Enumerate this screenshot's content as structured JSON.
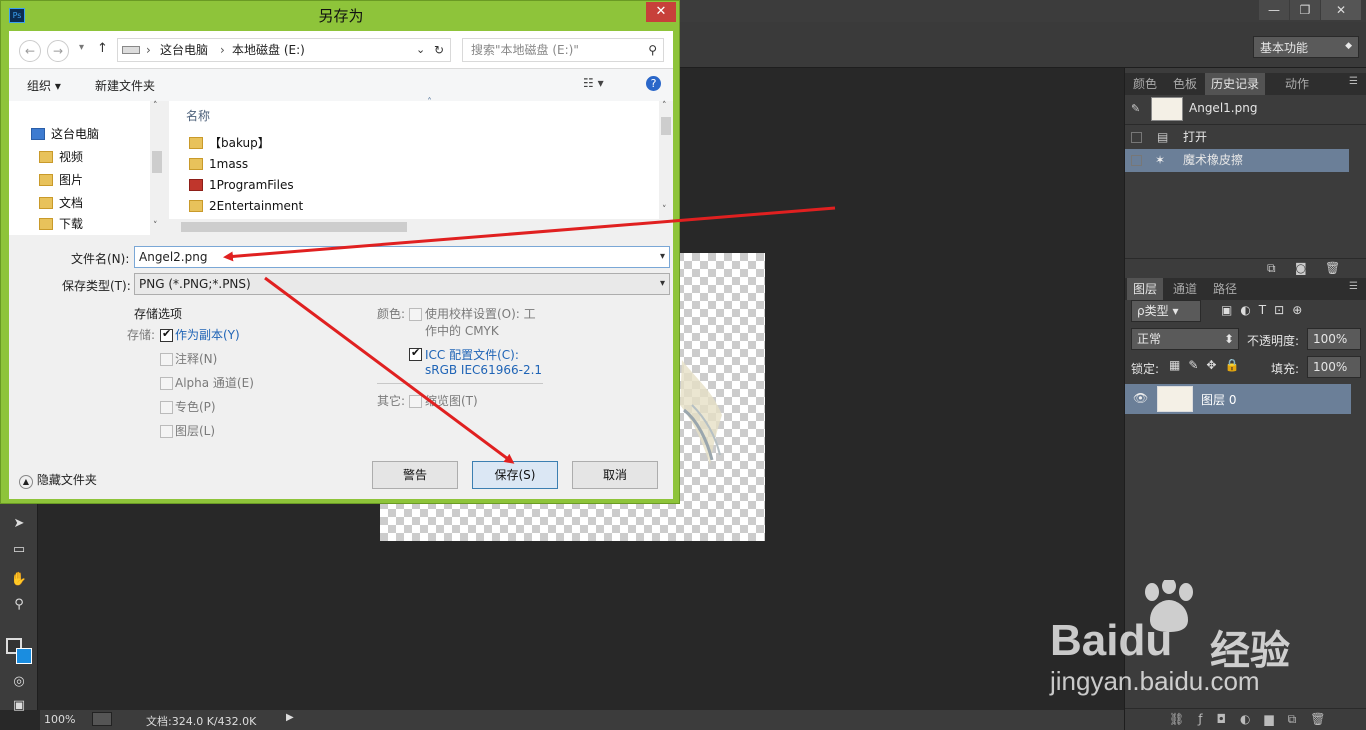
{
  "photoshop": {
    "workspace": "基本功能",
    "window_buttons": [
      "—",
      "❐",
      "✕"
    ],
    "status": {
      "zoom": "100%",
      "doc_size": "文档:324.0 K/432.0K"
    },
    "panels": {
      "history_tabs": [
        "颜色",
        "色板",
        "历史记录",
        "动作"
      ],
      "history_snapshot": "Angel1.png",
      "history_items": [
        "打开",
        "魔术橡皮擦"
      ],
      "layers_tabs": [
        "图层",
        "通道",
        "路径"
      ],
      "layer_filter": "ρ类型",
      "blend_mode": "正常",
      "opacity_label": "不透明度:",
      "opacity_value": "100%",
      "lock_label": "锁定:",
      "fill_label": "填充:",
      "fill_value": "100%",
      "layer_name": "图层 0"
    }
  },
  "dialog": {
    "title": "另存为",
    "close": "✕",
    "breadcrumb": [
      "这台电脑",
      "本地磁盘 (E:)"
    ],
    "search_placeholder": "搜索\"本地磁盘 (E:)\"",
    "organize": "组织 ▾",
    "new_folder": "新建文件夹",
    "nav_tree": [
      "这台电脑",
      "视频",
      "图片",
      "文档",
      "下载"
    ],
    "column_header": "名称",
    "files": [
      "【bakup】",
      "1mass",
      "1ProgramFiles",
      "2Entertainment"
    ],
    "filename_label": "文件名(N):",
    "filename_value": "Angel2.png",
    "filetype_label": "保存类型(T):",
    "filetype_value": "PNG (*.PNG;*.PNS)",
    "save_options_title": "存储选项",
    "save_label": "存储:",
    "options": {
      "as_copy": "作为副本(Y)",
      "notes": "注释(N)",
      "alpha": "Alpha 通道(E)",
      "spot": "专色(P)",
      "layers": "图层(L)"
    },
    "color_label": "颜色:",
    "proof_setup": "使用校样设置(O):  工",
    "proof_setup_2": "作中的 CMYK",
    "icc_profile": "ICC 配置文件(C):",
    "icc_value": "sRGB IEC61966-2.1",
    "other_label": "其它:",
    "thumbnail": "缩览图(T)",
    "hide_folders": "隐藏文件夹",
    "buttons": {
      "warning": "警告",
      "save": "保存(S)",
      "cancel": "取消"
    }
  },
  "watermark": {
    "brand": "Baidu",
    "brand_cn": "经验",
    "url": "jingyan.baidu.com"
  },
  "colors": {
    "dialog_frame": "#8ec43a",
    "arrow": "#e02020",
    "ps_bg": "#282828",
    "selection": "#6b7f98"
  }
}
